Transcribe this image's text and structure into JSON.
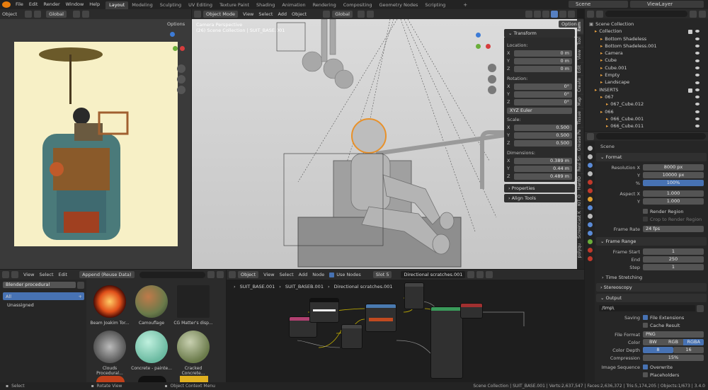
{
  "menu": [
    "File",
    "Edit",
    "Render",
    "Window",
    "Help"
  ],
  "workspaces": [
    "Layout",
    "Modeling",
    "Sculpting",
    "UV Editing",
    "Texture Paint",
    "Shading",
    "Animation",
    "Rendering",
    "Compositing",
    "Geometry Nodes",
    "Scripting"
  ],
  "scene": "Scene",
  "view_layer": "ViewLayer",
  "left_viewport": {
    "mode": "Object",
    "transform": "Global",
    "options": "Options"
  },
  "main_viewport": {
    "mode": "Object Mode",
    "menus": [
      "View",
      "Select",
      "Add",
      "Object"
    ],
    "transform": "Global",
    "options": "Options",
    "info1": "Camera Perspective",
    "info2": "(26) Scene Collection | SUIT_BASE.001"
  },
  "npanel": {
    "title": "Transform",
    "location": {
      "label": "Location:",
      "x": "0 m",
      "y": "0 m",
      "z": "0 m"
    },
    "rotation": {
      "label": "Rotation:",
      "x": "0°",
      "y": "0°",
      "z": "0°",
      "mode": "XYZ Euler"
    },
    "scale": {
      "label": "Scale:",
      "x": "0.500",
      "y": "0.500",
      "z": "0.500"
    },
    "dimensions": {
      "label": "Dimensions:",
      "x": "0.389 m",
      "y": "0.44 m",
      "z": "0.489 m"
    },
    "axes": [
      "X",
      "Y",
      "Z"
    ],
    "properties": "Properties",
    "align": "Align Tools"
  },
  "sidebar_tabs": [
    "Item",
    "Tool",
    "View",
    "Edit",
    "Create",
    "Map",
    "Tissue",
    "Grease Pe",
    "Real Sn",
    "HardO",
    "KIT O",
    "Screencast K",
    "polyqu"
  ],
  "outliner": {
    "root": "Scene Collection",
    "items": [
      {
        "name": "Collection",
        "indent": 1
      },
      {
        "name": "Bottom Shadeless",
        "indent": 2
      },
      {
        "name": "Bottom Shadeless.001",
        "indent": 2
      },
      {
        "name": "Camera",
        "indent": 2
      },
      {
        "name": "Cube",
        "indent": 2
      },
      {
        "name": "Cube.001",
        "indent": 2
      },
      {
        "name": "Empty",
        "indent": 2
      },
      {
        "name": "Landscape",
        "indent": 2
      },
      {
        "name": "INSERTS",
        "indent": 1
      },
      {
        "name": "067",
        "indent": 2
      },
      {
        "name": "067_Cube.012",
        "indent": 3
      },
      {
        "name": "066",
        "indent": 2
      },
      {
        "name": "066_Cube.001",
        "indent": 3
      },
      {
        "name": "066_Cube.011",
        "indent": 3
      }
    ]
  },
  "properties": {
    "scene_label": "Scene",
    "format": {
      "title": "Format",
      "res_x_label": "Resolution X",
      "res_x": "8000 px",
      "y_label": "Y",
      "res_y": "10000 px",
      "pct_label": "%",
      "pct": "100%",
      "aspect_x_label": "Aspect X",
      "aspect_x": "1.000",
      "aspect_y_label": "Y",
      "aspect_y": "1.000",
      "render_region": "Render Region",
      "crop": "Crop to Render Region",
      "frame_rate_label": "Frame Rate",
      "frame_rate": "24 fps"
    },
    "frame_range": {
      "title": "Frame Range",
      "start_label": "Frame Start",
      "start": "1",
      "end_label": "End",
      "end": "250",
      "step_label": "Step",
      "step": "1",
      "time_stretch": "Time Stretching",
      "stereo": "Stereoscopy"
    },
    "output": {
      "title": "Output",
      "path": "/tmp\\",
      "saving_label": "Saving",
      "file_ext": "File Extensions",
      "cache": "Cache Result",
      "format_label": "File Format",
      "format": "PNG",
      "color_label": "Color",
      "color_opts": [
        "BW",
        "RGB",
        "RGBA"
      ],
      "depth_label": "Color Depth",
      "depth_opts": [
        "8",
        "16"
      ],
      "compression_label": "Compression",
      "compression": "15%",
      "seq_label": "Image Sequence",
      "overwrite": "Overwrite",
      "placeholders": "Placeholders"
    }
  },
  "asset_browser": {
    "menus": [
      "View",
      "Select",
      "Edit"
    ],
    "import": "Append (Reuse Data)",
    "library": "Blender procedural",
    "catalog_all": "All",
    "catalog_unassigned": "Unassigned",
    "assets": [
      "Beam Joakim Tor...",
      "Camouflage",
      "CG Matter's disp...",
      "Clouds Procedural...",
      "Concrete - painte...",
      "Cracked Concrete..."
    ]
  },
  "node_editor": {
    "type": "Object",
    "menus": [
      "View",
      "Select",
      "Add",
      "Node"
    ],
    "use_nodes": "Use Nodes",
    "slot": "Slot 5",
    "material": "Directional scratches.001",
    "breadcrumb": [
      "SUIT_BASE.001",
      "SUIT_BASEB.001",
      "Directional scratches.001"
    ]
  },
  "statusbar": {
    "left": "Select",
    "mid": "Rotate View",
    "ctx": "Object Context Menu",
    "right": "Scene Collection | SUIT_BASE.001 | Verts:2,637,547 | Faces:2,636,372 | Tris:5,174,205 | Objects:1/673 | 3.4.0"
  }
}
